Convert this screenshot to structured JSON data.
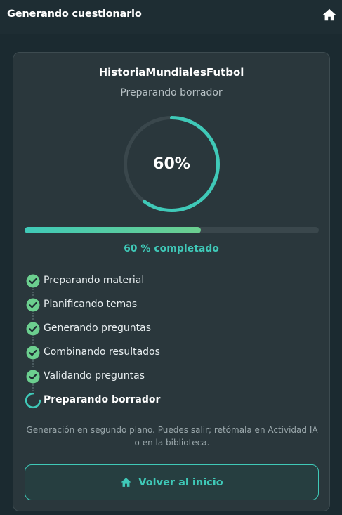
{
  "header": {
    "title": "Generando cuestionario",
    "home_icon": "home-icon"
  },
  "quiz": {
    "name": "HistoriaMundialesFutbol",
    "phase": "Preparando borrador",
    "progress": 60,
    "progress_label": "60%",
    "progress_text": "60 % completado"
  },
  "steps": [
    {
      "label": "Preparando material",
      "status": "done"
    },
    {
      "label": "Planificando temas",
      "status": "done"
    },
    {
      "label": "Generando preguntas",
      "status": "done"
    },
    {
      "label": "Combinando resultados",
      "status": "done"
    },
    {
      "label": "Validando preguntas",
      "status": "done"
    },
    {
      "label": "Preparando borrador",
      "status": "active"
    }
  ],
  "note": "Generación en segundo plano. Puedes salir; retómala en Actividad IA o en la biblioteca.",
  "back_button": {
    "label": "Volver al inicio"
  },
  "colors": {
    "accent": "#3fc9b8",
    "accent_green": "#6ccf8f",
    "ring_track": "#3a474c"
  }
}
